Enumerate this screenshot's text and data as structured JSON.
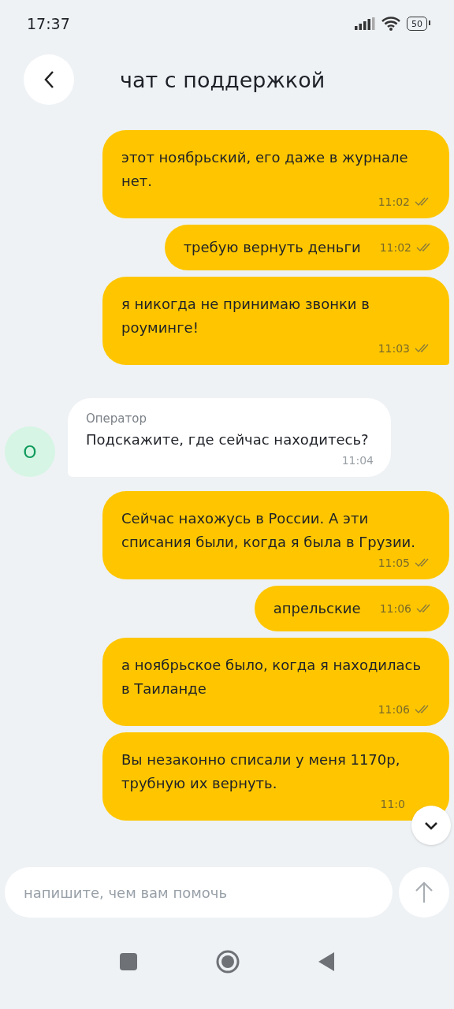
{
  "status_bar": {
    "time": "17:37",
    "battery": "50"
  },
  "header": {
    "title": "чат с поддержкой"
  },
  "messages": [
    {
      "kind": "outgoing",
      "text": "этот ноябрьский, его даже в журнале нет.",
      "time": "11:02",
      "read": true,
      "tail": false
    },
    {
      "kind": "short",
      "text": "требую вернуть деньги",
      "time": "11:02",
      "read": true,
      "tail": false
    },
    {
      "kind": "outgoing",
      "text": "я никогда не принимаю звонки в роуминге!",
      "time": "11:03",
      "read": true,
      "tail": true
    },
    {
      "kind": "incoming",
      "sender": "Оператор",
      "avatar": "О",
      "text": "Подскажите, где сейчас находитесь?",
      "time": "11:04"
    },
    {
      "kind": "outgoing",
      "text": "Сейчас нахожусь в России. А эти списания были, когда я была в Грузии.",
      "time": "11:05",
      "read": true,
      "tail": false
    },
    {
      "kind": "short",
      "text": "апрельские",
      "time": "11:06",
      "read": true,
      "tail": false
    },
    {
      "kind": "outgoing",
      "text": "а ноябрьское было, когда я находилась в Таиланде",
      "time": "11:06",
      "read": true,
      "tail": false
    },
    {
      "kind": "outgoing",
      "text": "Вы незаконно списали у меня 1170р, трубную их вернуть.",
      "time": "11:0",
      "tail": false
    }
  ],
  "composer": {
    "placeholder": "напишите, чем вам помочь"
  }
}
